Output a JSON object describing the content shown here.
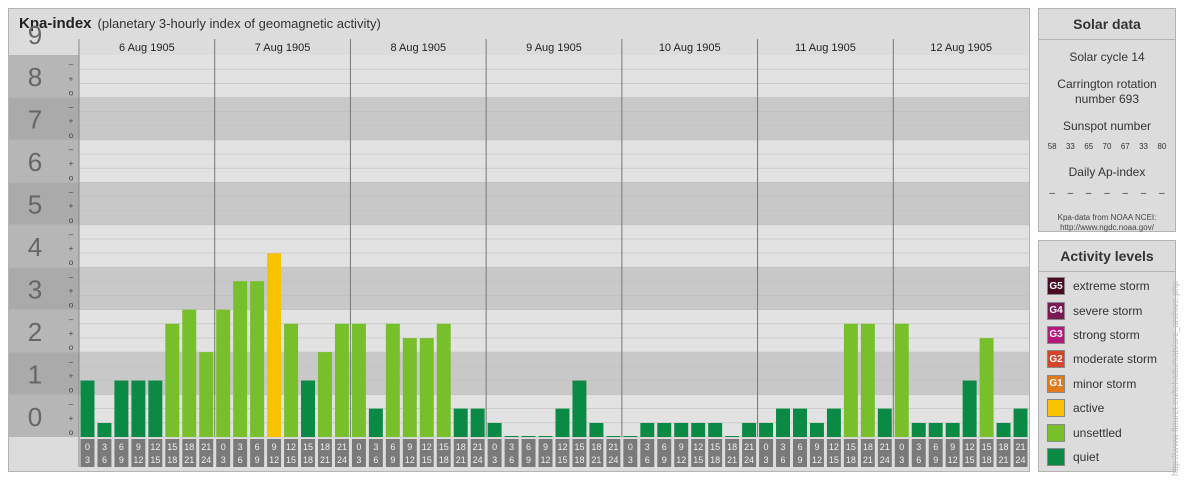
{
  "header": {
    "title": "Kpa-index",
    "subtitle": "(planetary 3-hourly index of geomagnetic activity)"
  },
  "chart_data": {
    "type": "bar",
    "ylim": [
      0,
      9
    ],
    "y_ticks": [
      "0",
      "1",
      "2",
      "3",
      "4",
      "5",
      "6",
      "7",
      "8",
      "9"
    ],
    "minor_tick_labels": [
      "o",
      "+",
      "–"
    ],
    "days": [
      "6 Aug 1905",
      "7 Aug 1905",
      "8 Aug 1905",
      "9 Aug 1905",
      "10 Aug 1905",
      "11 Aug 1905",
      "12 Aug 1905"
    ],
    "slot_start_labels": [
      "0",
      "3",
      "6",
      "9",
      "12",
      "15",
      "18",
      "21"
    ],
    "slot_end_labels": [
      "3",
      "6",
      "9",
      "12",
      "15",
      "18",
      "21",
      "24"
    ],
    "values": [
      1.33,
      0.33,
      1.33,
      1.33,
      1.33,
      2.67,
      3.0,
      2.0,
      3.0,
      3.67,
      3.67,
      4.33,
      2.67,
      1.33,
      2.0,
      2.67,
      2.67,
      0.67,
      2.67,
      2.33,
      2.33,
      2.67,
      0.67,
      0.67,
      0.33,
      0.0,
      0.0,
      0.0,
      0.67,
      1.33,
      0.33,
      0.0,
      0.0,
      0.33,
      0.33,
      0.33,
      0.33,
      0.33,
      0.0,
      0.33,
      0.33,
      0.67,
      0.67,
      0.33,
      0.67,
      2.67,
      2.67,
      0.67,
      2.67,
      0.33,
      0.33,
      0.33,
      1.33,
      2.33,
      0.33,
      0.67
    ],
    "colors": {
      "quiet": "#0a8a45",
      "unsettled": "#77bf2b",
      "active": "#f7c200",
      "g1": "#e07a1b",
      "g2": "#d6452a",
      "g3": "#b5177a",
      "g4": "#7a1a55",
      "g5": "#4a0a24"
    }
  },
  "solar": {
    "title": "Solar data",
    "cycle": "Solar cycle 14",
    "carrington_1": "Carrington rotation",
    "carrington_2": "number 693",
    "sunspot_title": "Sunspot number",
    "sunspots": [
      "58",
      "33",
      "65",
      "70",
      "67",
      "33",
      "80"
    ],
    "ap_title": "Daily Ap-index",
    "ap": [
      "–",
      "–",
      "–",
      "–",
      "–",
      "–",
      "–"
    ],
    "source_1": "Kpa-data from NOAA NCEI:",
    "source_2": "http://www.ngdc.noaa.gov/"
  },
  "activity": {
    "title": "Activity levels",
    "items": [
      {
        "badge": "G5",
        "label": "extreme storm",
        "color": "#4a0a24"
      },
      {
        "badge": "G4",
        "label": "severe storm",
        "color": "#7a1a55"
      },
      {
        "badge": "G3",
        "label": "strong storm",
        "color": "#b5177a"
      },
      {
        "badge": "G2",
        "label": "moderate storm",
        "color": "#d6452a"
      },
      {
        "badge": "G1",
        "label": "minor storm",
        "color": "#e07a1b"
      },
      {
        "badge": "",
        "label": "active",
        "color": "#f7c200"
      },
      {
        "badge": "",
        "label": "unsettled",
        "color": "#77bf2b"
      },
      {
        "badge": "",
        "label": "quiet",
        "color": "#0a8a45"
      }
    ]
  },
  "watermark": "http://www.fleuret.eu/tekadurkab/arc_archive.php"
}
